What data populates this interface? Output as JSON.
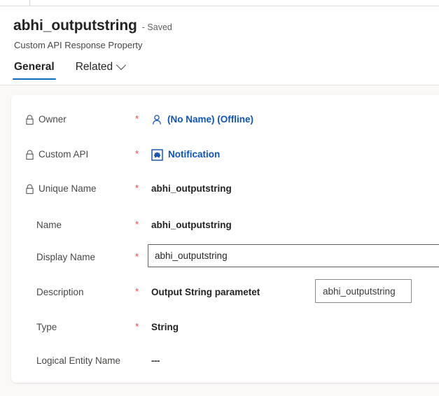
{
  "window": {
    "background_color": "#faf9f8",
    "card_background": "#ffffff"
  },
  "header": {
    "record_title": "abhi_outputstring",
    "save_state": "- Saved",
    "entity_subtitle": "Custom API Response Property",
    "accent_color": "#0f6cbd"
  },
  "tabs": [
    {
      "label": "General",
      "selected": true,
      "has_chevron": false,
      "icon": ""
    },
    {
      "label": "Related",
      "selected": false,
      "has_chevron": true,
      "icon": "chevron-down-icon"
    }
  ],
  "form": {
    "required_marker": "*",
    "fields": [
      {
        "label": "Owner",
        "locked": true,
        "lock_icon": "lock-icon",
        "required": true,
        "value": "(No Name) (Offline)",
        "value_type": "lookup-link",
        "value_icon": "contact-person-icon",
        "value_color": "#0f55b8"
      },
      {
        "label": "Custom API",
        "locked": true,
        "lock_icon": "lock-icon",
        "required": true,
        "value": "Notification",
        "value_type": "lookup-link",
        "value_icon": "custom-api-component-icon",
        "value_color": "#0f55b8"
      },
      {
        "label": "Unique Name",
        "locked": true,
        "lock_icon": "lock-icon",
        "required": true,
        "value": "abhi_outputstring",
        "value_type": "readonly-text"
      },
      {
        "label": "Name",
        "locked": false,
        "required": true,
        "value": "abhi_outputstring",
        "value_type": "readonly-text"
      },
      {
        "label": "Display Name",
        "locked": false,
        "required": true,
        "value": "abhi_outputstring",
        "value_type": "text-input",
        "placeholder": ""
      },
      {
        "label": "Description",
        "locked": false,
        "required": true,
        "value": "Output String parametet",
        "value_type": "readonly-text"
      },
      {
        "label": "Type",
        "locked": false,
        "required": true,
        "value": "String",
        "value_type": "readonly-text"
      },
      {
        "label": "Logical Entity Name",
        "locked": false,
        "required": false,
        "value": "---",
        "value_type": "empty-dashes"
      }
    ]
  },
  "flyout": {
    "text": "abhi_outputstring",
    "border_color": "#8a8886"
  }
}
